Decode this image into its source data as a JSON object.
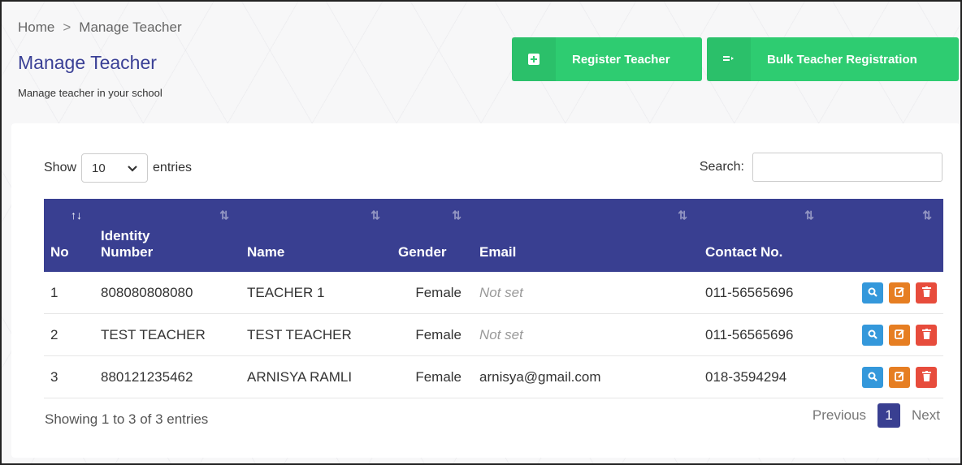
{
  "breadcrumb": {
    "home": "Home",
    "separator": ">",
    "current": "Manage Teacher"
  },
  "page": {
    "title": "Manage Teacher",
    "subtitle": "Manage teacher in your school"
  },
  "actions": {
    "register_label": "Register Teacher",
    "register_icon": "plus-square-icon",
    "bulk_label": "Bulk Teacher Registration",
    "bulk_icon": "list-add-icon",
    "color": "#2ecc71"
  },
  "table_controls": {
    "show_label": "Show",
    "entries_value": "10",
    "entries_label": "entries",
    "search_label": "Search:",
    "search_value": ""
  },
  "table": {
    "header_color": "#393f91",
    "columns": [
      {
        "line1": "",
        "line2": "No"
      },
      {
        "line1": "Identity",
        "line2": "Number"
      },
      {
        "line1": "",
        "line2": "Name"
      },
      {
        "line1": "",
        "line2": "Gender"
      },
      {
        "line1": "",
        "line2": "Email"
      },
      {
        "line1": "",
        "line2": "Contact No."
      },
      {
        "line1": "",
        "line2": ""
      }
    ],
    "rows": [
      {
        "no": "1",
        "identity": "808080808080",
        "name": "TEACHER 1",
        "gender": "Female",
        "email": "Not set",
        "email_set": false,
        "contact": "011-56565696"
      },
      {
        "no": "2",
        "identity": "TEST TEACHER",
        "name": "TEST TEACHER",
        "gender": "Female",
        "email": "Not set",
        "email_set": false,
        "contact": "011-56565696"
      },
      {
        "no": "3",
        "identity": "880121235462",
        "name": "ARNISYA RAMLI",
        "gender": "Female",
        "email": "arnisya@gmail.com",
        "email_set": true,
        "contact": "018-3594294"
      }
    ],
    "row_actions": {
      "view_icon": "search-icon",
      "edit_icon": "edit-icon",
      "delete_icon": "trash-icon"
    }
  },
  "footer": {
    "info": "Showing 1 to 3 of 3 entries",
    "prev_label": "Previous",
    "current_page": "1",
    "next_label": "Next"
  }
}
